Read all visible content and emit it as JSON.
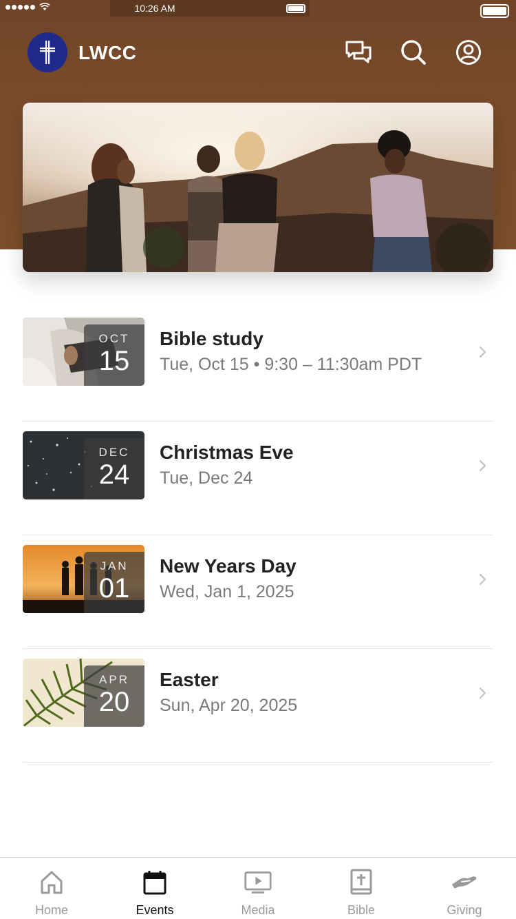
{
  "status_bar": {
    "time": "10:26 AM"
  },
  "app": {
    "title": "LWCC",
    "logo_color": "#1f2a8a",
    "header_color": "#7a4b2c",
    "actions": [
      {
        "name": "chat-icon"
      },
      {
        "name": "search-icon"
      },
      {
        "name": "profile-icon"
      }
    ]
  },
  "events": [
    {
      "month": "OCT",
      "day": "15",
      "title": "Bible study",
      "subtitle": "Tue, Oct 15 • 9:30 – 11:30am PDT"
    },
    {
      "month": "DEC",
      "day": "24",
      "title": "Christmas Eve",
      "subtitle": "Tue, Dec 24"
    },
    {
      "month": "JAN",
      "day": "01",
      "title": "New Years Day",
      "subtitle": "Wed, Jan 1, 2025"
    },
    {
      "month": "APR",
      "day": "20",
      "title": "Easter",
      "subtitle": "Sun, Apr 20, 2025"
    }
  ],
  "tabs": [
    {
      "label": "Home",
      "icon": "home-icon",
      "active": false
    },
    {
      "label": "Events",
      "icon": "calendar-icon",
      "active": true
    },
    {
      "label": "Media",
      "icon": "play-screen-icon",
      "active": false
    },
    {
      "label": "Bible",
      "icon": "bible-icon",
      "active": false
    },
    {
      "label": "Giving",
      "icon": "giving-hand-icon",
      "active": false
    }
  ]
}
